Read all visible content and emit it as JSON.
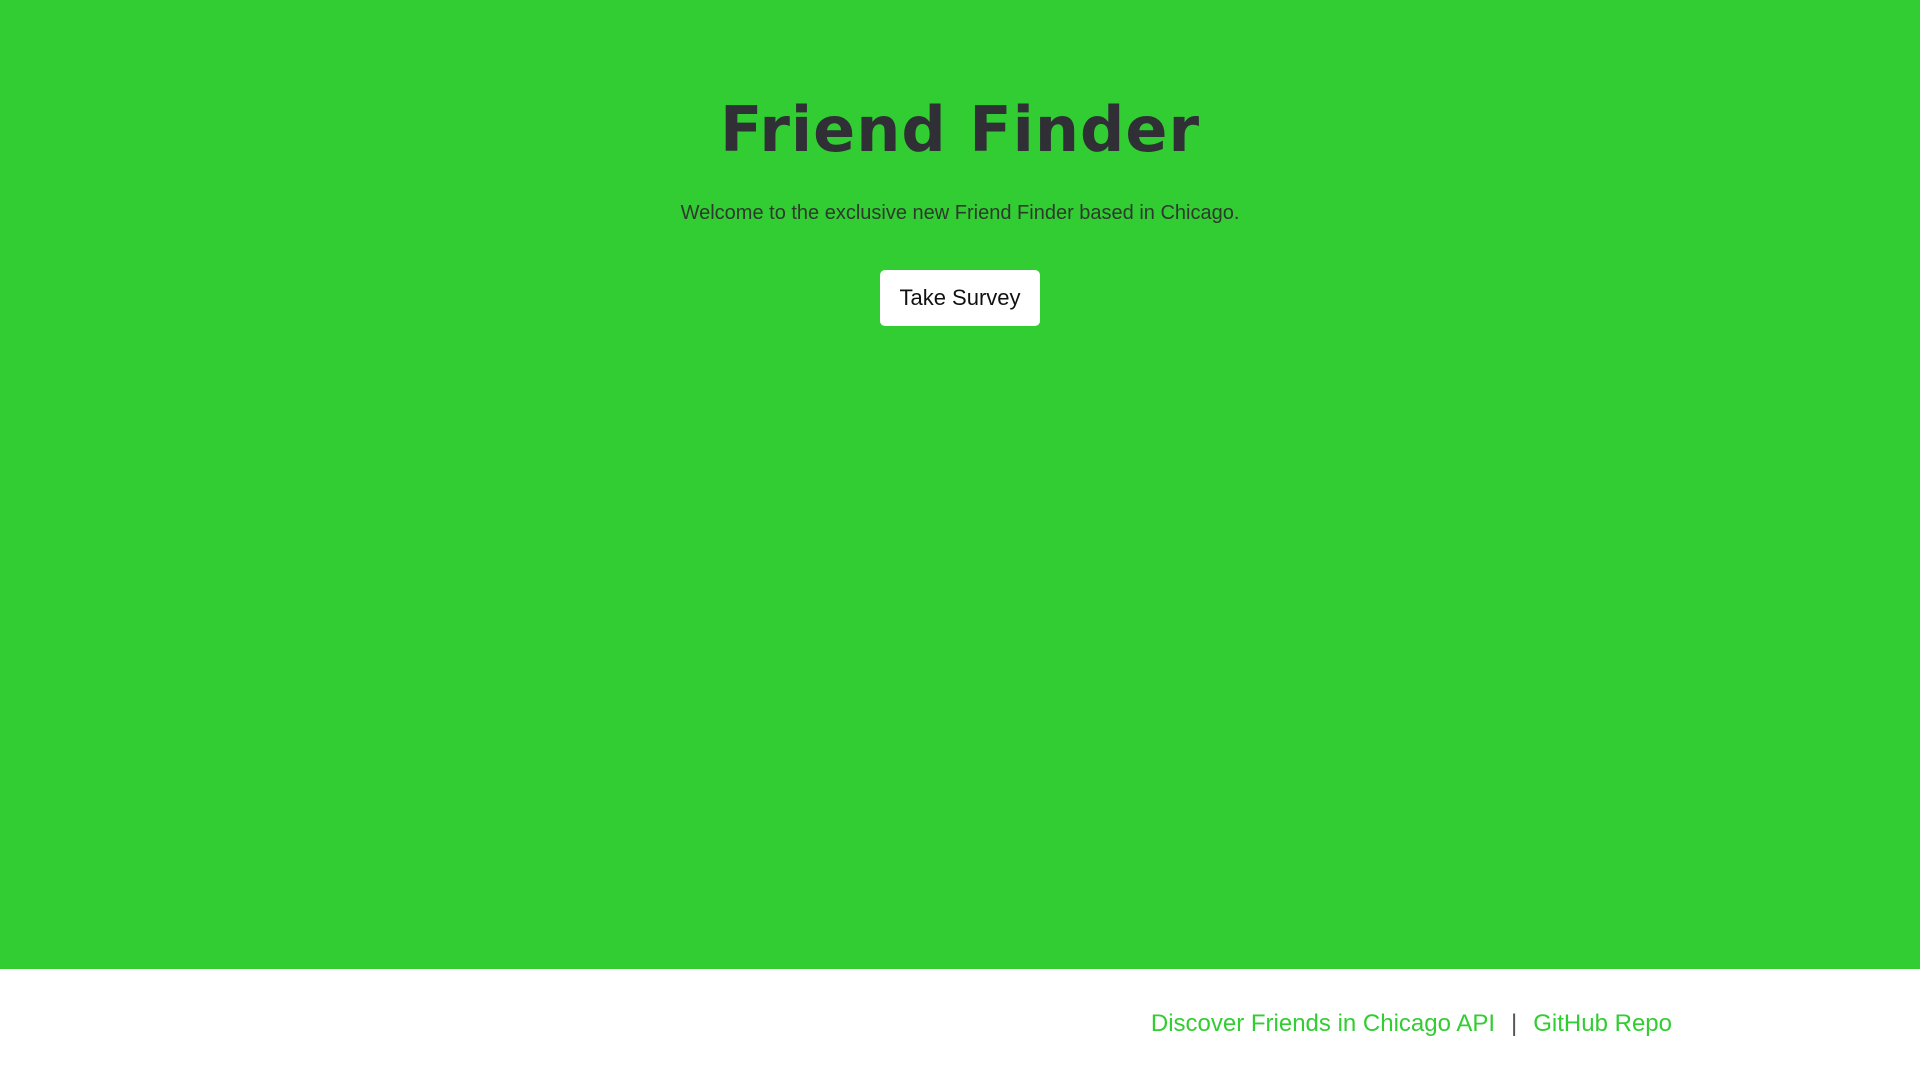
{
  "colors": {
    "hero_background": "#32cd32",
    "title_color": "#2f2f35",
    "button_background": "#ffffff",
    "footer_background": "#ffffff",
    "link_color": "#32cd32"
  },
  "hero": {
    "title": "Friend Finder",
    "subtitle": "Welcome to the exclusive new Friend Finder based in Chicago.",
    "button_label": "Take Survey"
  },
  "footer": {
    "links": [
      {
        "label": "Discover Friends in Chicago API"
      },
      {
        "label": "GitHub Repo"
      }
    ],
    "separator": "|"
  }
}
